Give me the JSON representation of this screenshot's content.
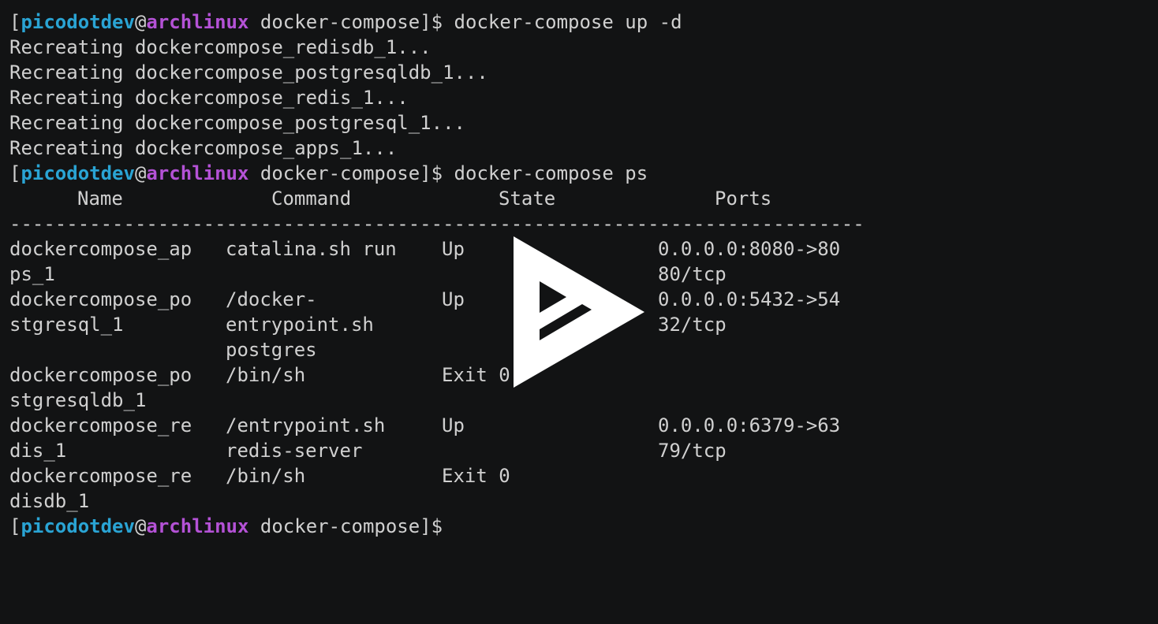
{
  "prompt": {
    "open": "[",
    "user": "picodotdev",
    "at": "@",
    "host": "archlinux",
    "dir_suffix": " docker-compose]$"
  },
  "commands": {
    "up": " docker-compose up -d",
    "ps": " docker-compose ps"
  },
  "recreating": [
    "Recreating dockercompose_redisdb_1...",
    "Recreating dockercompose_postgresqldb_1...",
    "Recreating dockercompose_redis_1...",
    "Recreating dockercompose_postgresql_1...",
    "Recreating dockercompose_apps_1..."
  ],
  "ps_table": {
    "headers": {
      "name": "Name",
      "command": "Command",
      "state": "State",
      "ports": "Ports"
    },
    "separator": "---------------------------------------------------------------------------",
    "rows": [
      {
        "name": [
          "dockercompose_ap",
          "ps_1"
        ],
        "command": [
          "catalina.sh run"
        ],
        "state": "Up",
        "ports": [
          "0.0.0.0:8080->80",
          "80/tcp"
        ]
      },
      {
        "name": [
          "dockercompose_po",
          "stgresql_1"
        ],
        "command": [
          "/docker-",
          "entrypoint.sh",
          "postgres"
        ],
        "state": "Up",
        "ports": [
          "0.0.0.0:5432->54",
          "32/tcp"
        ]
      },
      {
        "name": [
          "dockercompose_po",
          "stgresqldb_1"
        ],
        "command": [
          "/bin/sh"
        ],
        "state": "Exit 0",
        "ports": []
      },
      {
        "name": [
          "dockercompose_re",
          "dis_1"
        ],
        "command": [
          "/entrypoint.sh",
          "redis-server"
        ],
        "state": "Up",
        "ports": [
          "0.0.0.0:6379->63",
          "79/tcp"
        ]
      },
      {
        "name": [
          "dockercompose_re",
          "disdb_1"
        ],
        "command": [
          "/bin/sh"
        ],
        "state": "Exit 0",
        "ports": []
      }
    ]
  },
  "overlay": {
    "icon": "asciinema-play-icon"
  },
  "colors": {
    "background": "#121314",
    "text": "#d0d0d0",
    "user": "#2aa4d4",
    "host": "#b452d6",
    "overlay": "#ffffff"
  }
}
